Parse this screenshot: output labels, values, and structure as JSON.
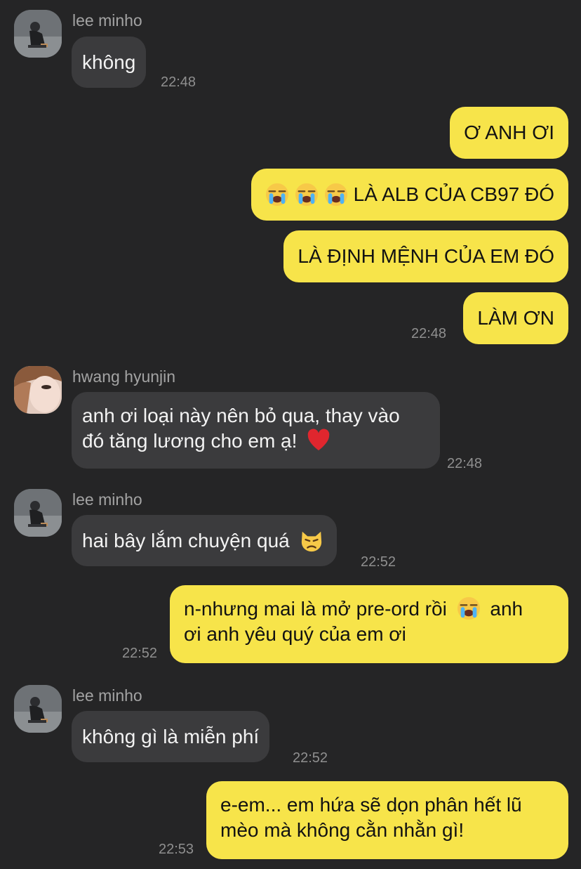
{
  "messages": [
    {
      "sender": "lee minho",
      "text": "không",
      "time": "22:48"
    },
    {
      "text": "Ơ ANH ƠI"
    },
    {
      "text_after_emoji": "LÀ ALB CỦA CB97 ĐÓ",
      "emojis": [
        "loudly-crying-face",
        "loudly-crying-face",
        "loudly-crying-face"
      ]
    },
    {
      "text": "LÀ ĐỊNH MỆNH CỦA EM ĐÓ"
    },
    {
      "text": "LÀM ƠN",
      "time": "22:48"
    },
    {
      "sender": "hwang hyunjin",
      "line1": "anh ơi loại này nên bỏ qua, thay vào",
      "line2": "đó tăng lương cho em ạ!",
      "emoji": "red-heart",
      "time": "22:48"
    },
    {
      "sender": "lee minho",
      "text": "hai bây lắm chuyện quá",
      "emoji": "pouting-cat-face",
      "time": "22:52"
    },
    {
      "line1_a": "n-nhưng mai là mở pre-ord rồi",
      "line1_b": "anh",
      "line2": "ơi anh yêu quý của em ơi",
      "emoji": "loudly-crying-face",
      "time": "22:52"
    },
    {
      "sender": "lee minho",
      "text": "không gì là miễn phí",
      "time": "22:52"
    },
    {
      "line1": "e-em... em hứa sẽ dọn phân hết lũ",
      "line2": "mèo mà không cằn nhằn gì!",
      "time": "22:53"
    }
  ],
  "colors": {
    "background": "#252526",
    "incoming_bubble": "#3b3b3d",
    "outgoing_bubble": "#f7e44a",
    "sender_name": "#a3a3a3",
    "timestamp": "#8f8f8f"
  }
}
